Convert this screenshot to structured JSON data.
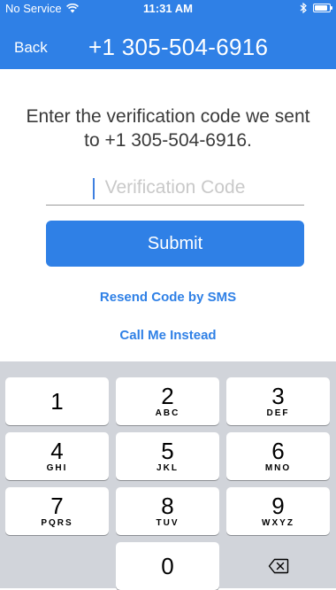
{
  "status_bar": {
    "carrier": "No Service",
    "time": "11:31 AM",
    "wifi_icon": "wifi-icon",
    "bluetooth_icon": "bluetooth-icon",
    "battery_icon": "battery-icon",
    "battery_level": 0.9
  },
  "nav": {
    "back_label": "Back",
    "title": "+1 305-504-6916"
  },
  "main": {
    "instructions": "Enter the verification code we sent to +1 305-504-6916.",
    "code_input": {
      "placeholder": "Verification Code",
      "value": ""
    },
    "submit_label": "Submit",
    "resend_label": "Resend Code by SMS",
    "call_label": "Call Me Instead"
  },
  "keypad": {
    "keys": [
      {
        "digit": "1",
        "letters": ""
      },
      {
        "digit": "2",
        "letters": "ABC"
      },
      {
        "digit": "3",
        "letters": "DEF"
      },
      {
        "digit": "4",
        "letters": "GHI"
      },
      {
        "digit": "5",
        "letters": "JKL"
      },
      {
        "digit": "6",
        "letters": "MNO"
      },
      {
        "digit": "7",
        "letters": "PQRS"
      },
      {
        "digit": "8",
        "letters": "TUV"
      },
      {
        "digit": "9",
        "letters": "WXYZ"
      },
      {
        "digit": "0",
        "letters": ""
      }
    ],
    "delete_icon": "backspace-icon"
  },
  "colors": {
    "accent": "#2f80e6",
    "keypad_background": "#d1d4da",
    "key_background": "#ffffff",
    "text_dark": "#3a3a3a",
    "placeholder": "#c9c9c9"
  }
}
